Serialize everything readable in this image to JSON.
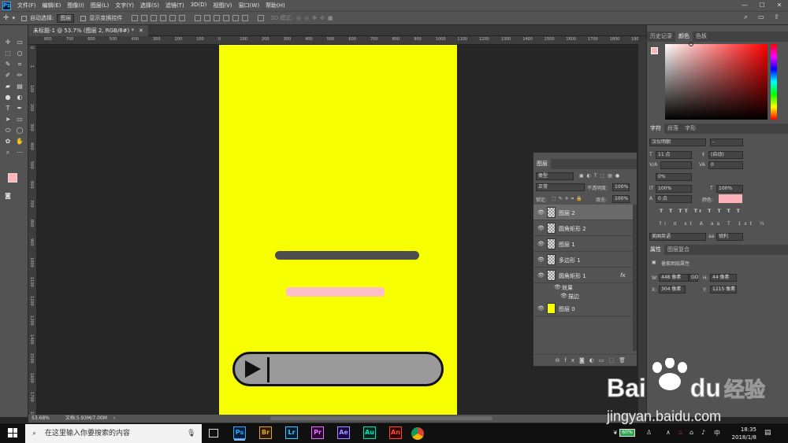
{
  "menu": [
    "文件(F)",
    "编辑(E)",
    "图像(I)",
    "图层(L)",
    "文字(Y)",
    "选择(S)",
    "滤镜(T)",
    "3D(D)",
    "视图(V)",
    "窗口(W)",
    "帮助(H)"
  ],
  "options": {
    "auto_select": "自动选择:",
    "layer_sel": "图层",
    "transform": "显示变换控件",
    "mode3d": "3D 模式:"
  },
  "doc_tab": "未标题-1 @ 53.7% (图层 2, RGB/8#) *",
  "ruler_h": [
    "800",
    "700",
    "600",
    "500",
    "400",
    "300",
    "200",
    "100",
    "0",
    "100",
    "200",
    "300",
    "400",
    "500",
    "600",
    "700",
    "800",
    "900",
    "1000",
    "1100",
    "1200",
    "1300",
    "1400",
    "1500",
    "1600",
    "1700",
    "1800",
    "1900"
  ],
  "ruler_v": [
    "0",
    "1",
    "100",
    "200",
    "300",
    "400",
    "500",
    "600",
    "700",
    "800",
    "900",
    "1000",
    "1100",
    "1200",
    "1300",
    "1400",
    "1500",
    "1600",
    "1700",
    "1800"
  ],
  "status": {
    "zoom": "53.68%",
    "doc": "文档:5.93M/7.00M"
  },
  "history_tabs": [
    "历史记录",
    "颜色",
    "色板"
  ],
  "char_tabs": [
    "字符",
    "段落",
    "字形"
  ],
  "char": {
    "font": "汉仪明朝",
    "style": "-",
    "size": "11 点",
    "leading": "(自动)",
    "kerning": "",
    "tracking": "0",
    "scale_pct": "0%",
    "vscale": "100%",
    "hscale": "100%",
    "baseline": "0 点",
    "color_label": "颜色:",
    "lang": "美国英语",
    "aa": "锐利",
    "aa_label": "aa"
  },
  "props_tabs": [
    "属性",
    "图层复合"
  ],
  "props": {
    "title": "叠套图层属性",
    "w_label": "W:",
    "w": "448 像素",
    "h_label": "H:",
    "h": "44 像素",
    "x_label": "X:",
    "x": "304 像素",
    "y_label": "Y:",
    "y": "1215 像素",
    "link": "GO"
  },
  "layers": {
    "title": "图层",
    "filter": "类型",
    "blend": "正常",
    "opacity_label": "不透明度:",
    "opacity": "100%",
    "lock_label": "锁定:",
    "fill_label": "填充:",
    "fill": "100%",
    "rows": [
      {
        "name": "图层 2",
        "selected": true
      },
      {
        "name": "圆角矩形 2"
      },
      {
        "name": "图层 1"
      },
      {
        "name": "多边形 1"
      },
      {
        "name": "圆角矩形 1",
        "fx": "fx"
      },
      {
        "name": "效果",
        "sub": true
      },
      {
        "name": "描边",
        "sub2": true
      },
      {
        "name": "图层 0",
        "yellow": true
      }
    ]
  },
  "taskbar": {
    "search": "在这里输入你要搜索的内容",
    "apps": [
      "Ps",
      "Br",
      "Lr",
      "Pr",
      "Ae",
      "Au",
      "An"
    ],
    "battery": "60%",
    "ime": "中",
    "time": "18:35",
    "date": "2018/1/8"
  },
  "watermark": {
    "brand": "Bai",
    "brand2": "du",
    "cn": "经验",
    "url": "jingyan.baidu.com"
  },
  "colors": {
    "canvas": "#f7ff00",
    "bar_dark": "#4d4d4d",
    "bar_pink": "#ffbfc9",
    "player_gray": "#9a9a9a",
    "fg": "#ffb3b8"
  }
}
